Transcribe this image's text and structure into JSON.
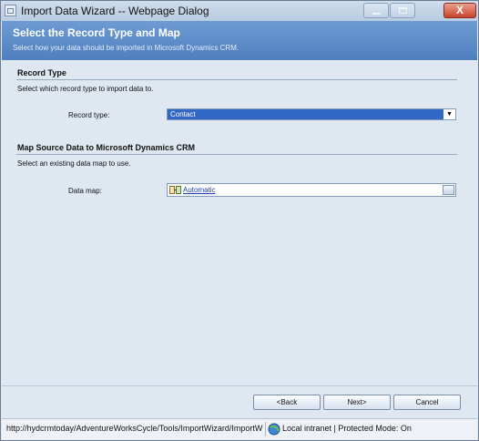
{
  "window": {
    "title": "Import Data Wizard -- Webpage Dialog",
    "close_glyph": "X"
  },
  "banner": {
    "title": "Select the Record Type and Map",
    "subtitle": "Select how your data should be imported in Microsoft Dynamics CRM."
  },
  "record_type_section": {
    "title": "Record Type",
    "description": "Select which record type to import data to.",
    "field_label": "Record type:",
    "selected_value": "Contact"
  },
  "map_section": {
    "title": "Map Source Data to Microsoft Dynamics CRM",
    "description": "Select an existing data map to use.",
    "field_label": "Data map:",
    "value": "Automatic"
  },
  "buttons": {
    "back": "<Back",
    "next": "Next>",
    "cancel": "Cancel"
  },
  "statusbar": {
    "url": "http://hydcrmtoday/AdventureWorksCycle/Tools/ImportWizard/ImportW",
    "zone": "Local intranet | Protected Mode: On"
  },
  "colors": {
    "banner": "#4f7fbf",
    "selection": "#3168c6",
    "link": "#1a3fb4"
  }
}
